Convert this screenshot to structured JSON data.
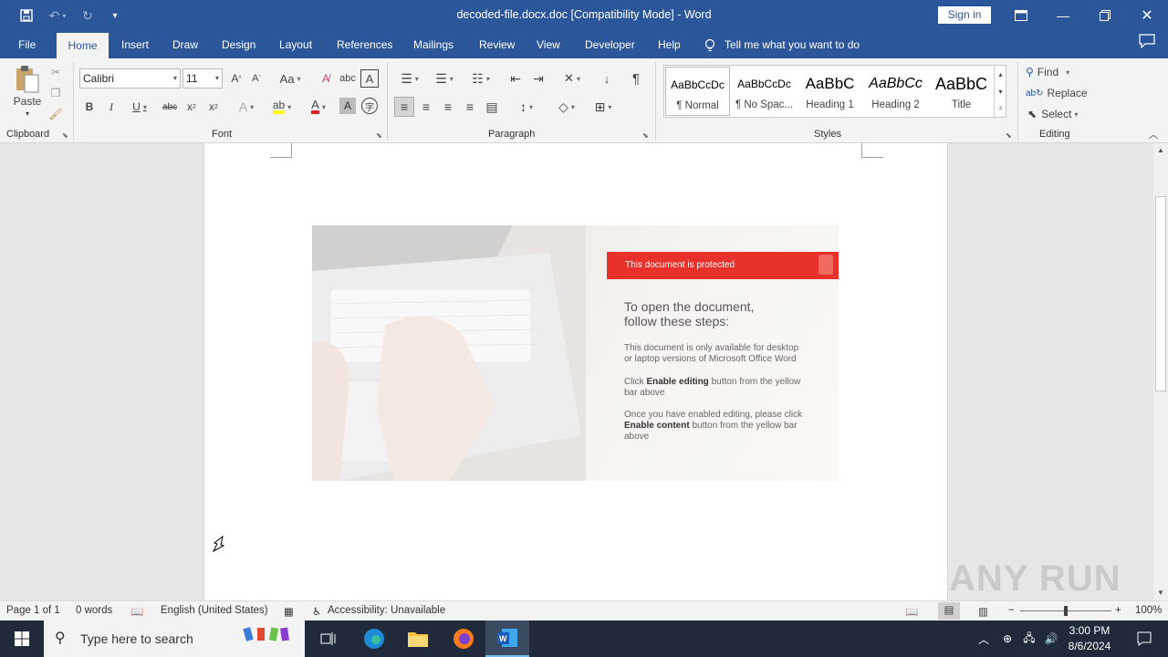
{
  "titlebar": {
    "doc_title": "decoded-file.docx.doc [Compatibility Mode]  -  Word",
    "sign_in": "Sign in"
  },
  "menu": {
    "tabs": [
      "File",
      "Home",
      "Insert",
      "Draw",
      "Design",
      "Layout",
      "References",
      "Mailings",
      "Review",
      "View",
      "Developer",
      "Help"
    ],
    "active_tab": "Home",
    "tell_me": "Tell me what you want to do"
  },
  "ribbon": {
    "clipboard": {
      "paste": "Paste",
      "label": "Clipboard"
    },
    "font": {
      "name": "Calibri",
      "size": "11",
      "label": "Font"
    },
    "paragraph": {
      "label": "Paragraph"
    },
    "styles": {
      "label": "Styles",
      "items": [
        {
          "preview": "AaBbCcDc",
          "name": "¶ Normal"
        },
        {
          "preview": "AaBbCcDc",
          "name": "¶ No Spac..."
        },
        {
          "preview": "AaBbC",
          "name": "Heading 1"
        },
        {
          "preview": "AaBbCc",
          "name": "Heading 2"
        },
        {
          "preview": "AaBbC",
          "name": "Title"
        }
      ]
    },
    "editing": {
      "find": "Find",
      "replace": "Replace",
      "select": "Select",
      "label": "Editing"
    }
  },
  "lure": {
    "banner": "This document is protected",
    "heading_1": "To open the document,",
    "heading_2": "follow these steps:",
    "p1": "This document is only available for desktop or laptop versions of Microsoft Office Word",
    "p2_pre": "Click ",
    "p2_bold": "Enable editing",
    "p2_post": " button from the yellow bar above",
    "p3_pre": "Once you have enabled editing, please click ",
    "p3_bold": "Enable content",
    "p3_post": " button from the yellow bar above"
  },
  "statusbar": {
    "page": "Page 1 of 1",
    "words": "0 words",
    "language": "English (United States)",
    "accessibility": "Accessibility: Unavailable",
    "zoom": "100%"
  },
  "taskbar": {
    "search_placeholder": "Type here to search",
    "time": "3:00 PM",
    "date": "8/6/2024"
  },
  "watermark": "ANY RUN",
  "colors": {
    "word_blue": "#2b579a",
    "banner_red": "#e8312a",
    "taskbar": "#1f2a3a"
  }
}
